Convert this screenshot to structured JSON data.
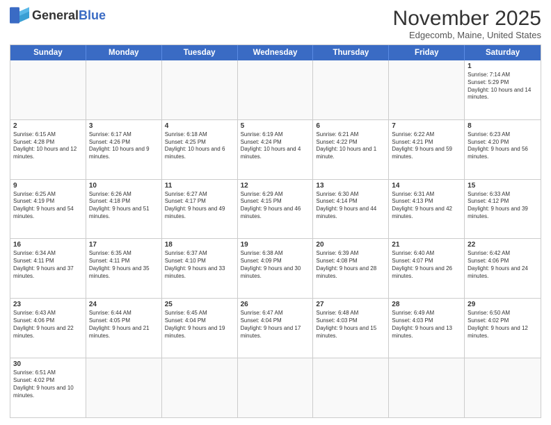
{
  "header": {
    "logo_general": "General",
    "logo_blue": "Blue",
    "month_title": "November 2025",
    "subtitle": "Edgecomb, Maine, United States"
  },
  "days_of_week": [
    "Sunday",
    "Monday",
    "Tuesday",
    "Wednesday",
    "Thursday",
    "Friday",
    "Saturday"
  ],
  "weeks": [
    [
      {
        "day": "",
        "info": ""
      },
      {
        "day": "",
        "info": ""
      },
      {
        "day": "",
        "info": ""
      },
      {
        "day": "",
        "info": ""
      },
      {
        "day": "",
        "info": ""
      },
      {
        "day": "",
        "info": ""
      },
      {
        "day": "1",
        "info": "Sunrise: 7:14 AM\nSunset: 5:29 PM\nDaylight: 10 hours and 14 minutes."
      }
    ],
    [
      {
        "day": "2",
        "info": "Sunrise: 6:15 AM\nSunset: 4:28 PM\nDaylight: 10 hours and 12 minutes."
      },
      {
        "day": "3",
        "info": "Sunrise: 6:17 AM\nSunset: 4:26 PM\nDaylight: 10 hours and 9 minutes."
      },
      {
        "day": "4",
        "info": "Sunrise: 6:18 AM\nSunset: 4:25 PM\nDaylight: 10 hours and 6 minutes."
      },
      {
        "day": "5",
        "info": "Sunrise: 6:19 AM\nSunset: 4:24 PM\nDaylight: 10 hours and 4 minutes."
      },
      {
        "day": "6",
        "info": "Sunrise: 6:21 AM\nSunset: 4:22 PM\nDaylight: 10 hours and 1 minute."
      },
      {
        "day": "7",
        "info": "Sunrise: 6:22 AM\nSunset: 4:21 PM\nDaylight: 9 hours and 59 minutes."
      },
      {
        "day": "8",
        "info": "Sunrise: 6:23 AM\nSunset: 4:20 PM\nDaylight: 9 hours and 56 minutes."
      }
    ],
    [
      {
        "day": "9",
        "info": "Sunrise: 6:25 AM\nSunset: 4:19 PM\nDaylight: 9 hours and 54 minutes."
      },
      {
        "day": "10",
        "info": "Sunrise: 6:26 AM\nSunset: 4:18 PM\nDaylight: 9 hours and 51 minutes."
      },
      {
        "day": "11",
        "info": "Sunrise: 6:27 AM\nSunset: 4:17 PM\nDaylight: 9 hours and 49 minutes."
      },
      {
        "day": "12",
        "info": "Sunrise: 6:29 AM\nSunset: 4:15 PM\nDaylight: 9 hours and 46 minutes."
      },
      {
        "day": "13",
        "info": "Sunrise: 6:30 AM\nSunset: 4:14 PM\nDaylight: 9 hours and 44 minutes."
      },
      {
        "day": "14",
        "info": "Sunrise: 6:31 AM\nSunset: 4:13 PM\nDaylight: 9 hours and 42 minutes."
      },
      {
        "day": "15",
        "info": "Sunrise: 6:33 AM\nSunset: 4:12 PM\nDaylight: 9 hours and 39 minutes."
      }
    ],
    [
      {
        "day": "16",
        "info": "Sunrise: 6:34 AM\nSunset: 4:11 PM\nDaylight: 9 hours and 37 minutes."
      },
      {
        "day": "17",
        "info": "Sunrise: 6:35 AM\nSunset: 4:11 PM\nDaylight: 9 hours and 35 minutes."
      },
      {
        "day": "18",
        "info": "Sunrise: 6:37 AM\nSunset: 4:10 PM\nDaylight: 9 hours and 33 minutes."
      },
      {
        "day": "19",
        "info": "Sunrise: 6:38 AM\nSunset: 4:09 PM\nDaylight: 9 hours and 30 minutes."
      },
      {
        "day": "20",
        "info": "Sunrise: 6:39 AM\nSunset: 4:08 PM\nDaylight: 9 hours and 28 minutes."
      },
      {
        "day": "21",
        "info": "Sunrise: 6:40 AM\nSunset: 4:07 PM\nDaylight: 9 hours and 26 minutes."
      },
      {
        "day": "22",
        "info": "Sunrise: 6:42 AM\nSunset: 4:06 PM\nDaylight: 9 hours and 24 minutes."
      }
    ],
    [
      {
        "day": "23",
        "info": "Sunrise: 6:43 AM\nSunset: 4:06 PM\nDaylight: 9 hours and 22 minutes."
      },
      {
        "day": "24",
        "info": "Sunrise: 6:44 AM\nSunset: 4:05 PM\nDaylight: 9 hours and 21 minutes."
      },
      {
        "day": "25",
        "info": "Sunrise: 6:45 AM\nSunset: 4:04 PM\nDaylight: 9 hours and 19 minutes."
      },
      {
        "day": "26",
        "info": "Sunrise: 6:47 AM\nSunset: 4:04 PM\nDaylight: 9 hours and 17 minutes."
      },
      {
        "day": "27",
        "info": "Sunrise: 6:48 AM\nSunset: 4:03 PM\nDaylight: 9 hours and 15 minutes."
      },
      {
        "day": "28",
        "info": "Sunrise: 6:49 AM\nSunset: 4:03 PM\nDaylight: 9 hours and 13 minutes."
      },
      {
        "day": "29",
        "info": "Sunrise: 6:50 AM\nSunset: 4:02 PM\nDaylight: 9 hours and 12 minutes."
      }
    ],
    [
      {
        "day": "30",
        "info": "Sunrise: 6:51 AM\nSunset: 4:02 PM\nDaylight: 9 hours and 10 minutes."
      },
      {
        "day": "",
        "info": ""
      },
      {
        "day": "",
        "info": ""
      },
      {
        "day": "",
        "info": ""
      },
      {
        "day": "",
        "info": ""
      },
      {
        "day": "",
        "info": ""
      },
      {
        "day": "",
        "info": ""
      }
    ]
  ]
}
